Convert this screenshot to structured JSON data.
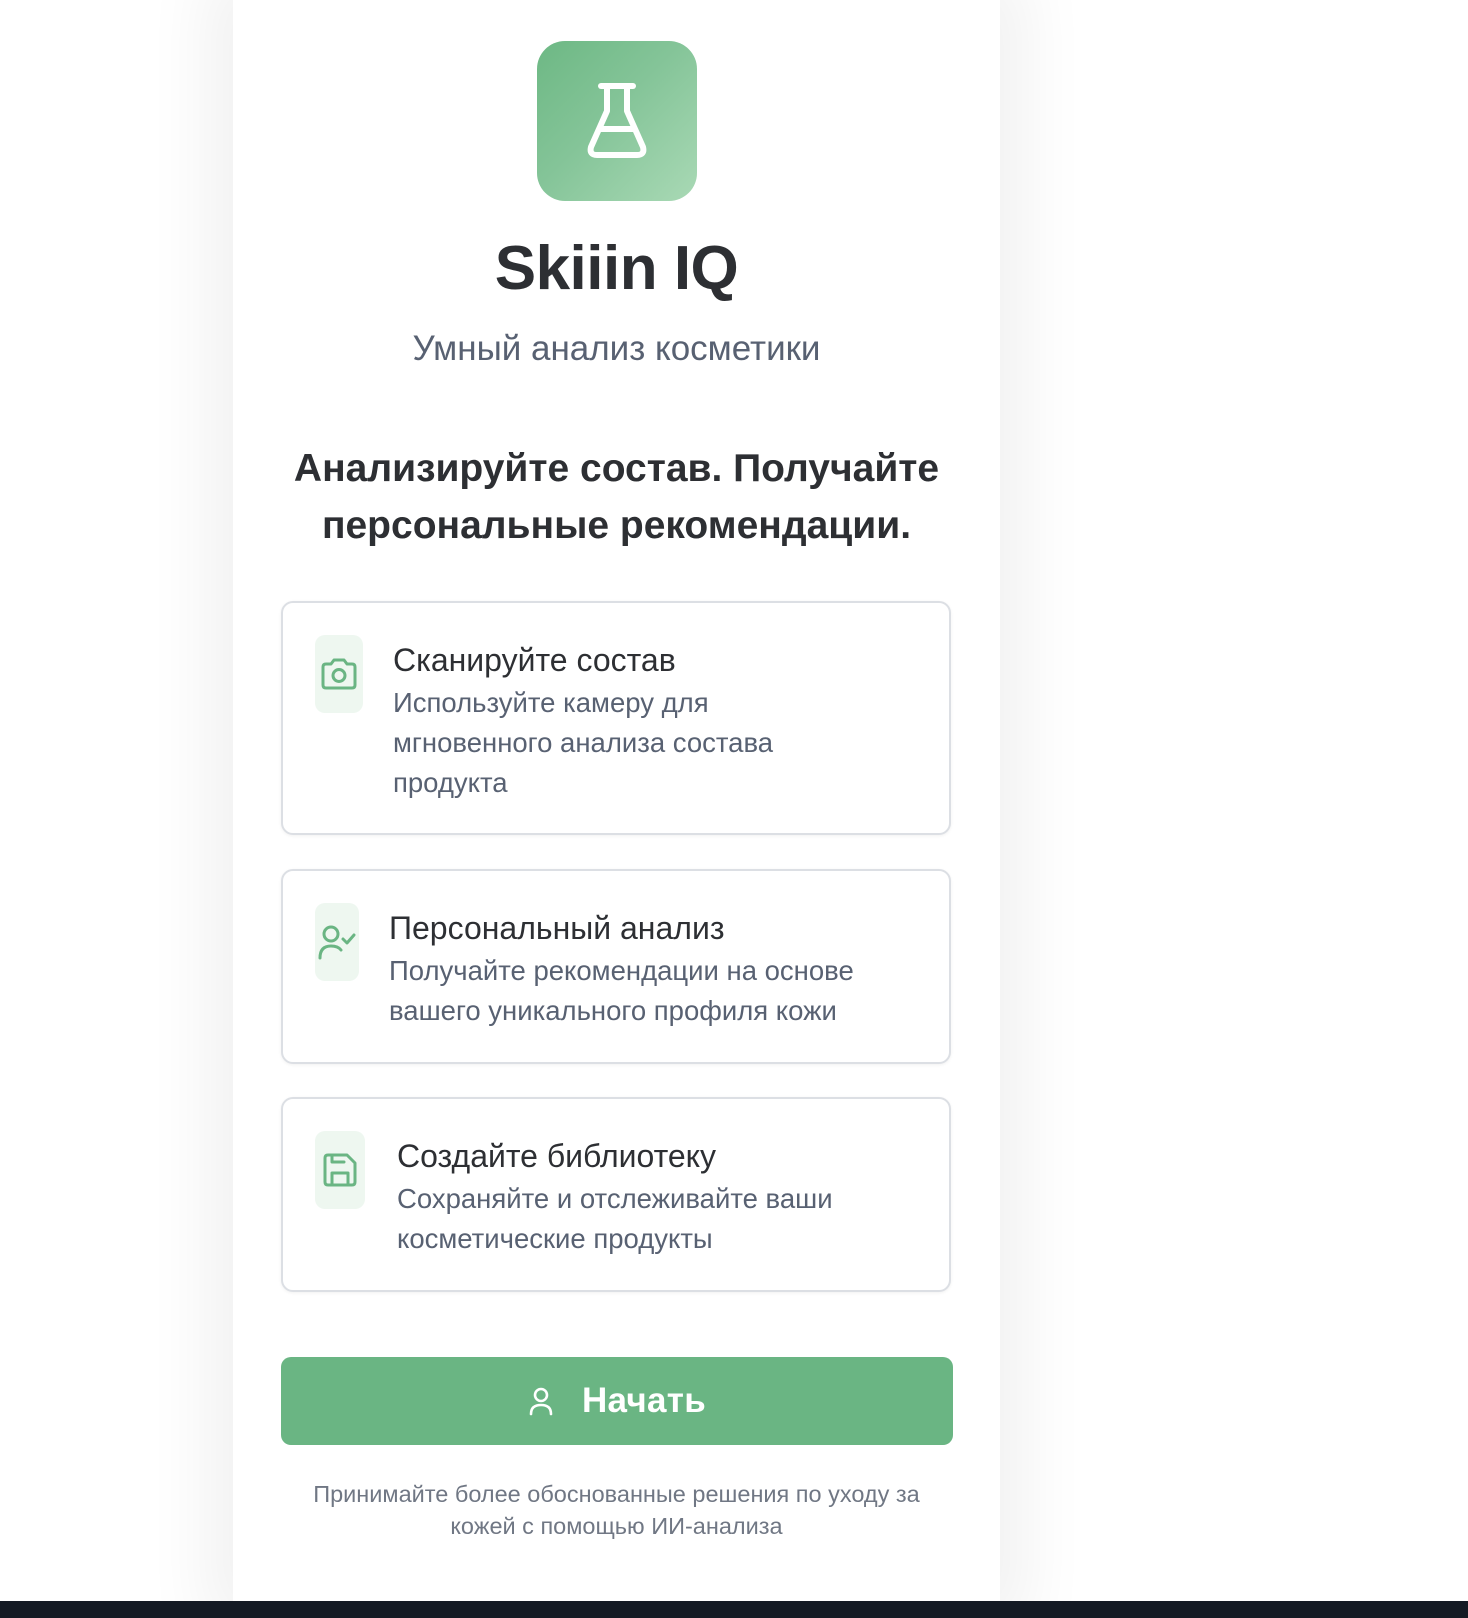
{
  "app": {
    "title": "Skiiin IQ",
    "subtitle": "Умный анализ косметики",
    "logo_icon": "flask-icon",
    "accent_color": "#6ab583"
  },
  "hero": {
    "headline_line1": "Анализируйте состав. Получайте",
    "headline_line2": "персональные рекомендации."
  },
  "features": [
    {
      "icon": "camera-icon",
      "title": "Сканируйте состав",
      "desc_lines": [
        "Используйте камеру для",
        "мгновенного анализа состава",
        "продукта"
      ]
    },
    {
      "icon": "user-check-icon",
      "title": "Персональный анализ",
      "desc_lines": [
        "Получайте рекомендации на основе",
        "вашего уникального профиля кожи"
      ]
    },
    {
      "icon": "save-icon",
      "title": "Создайте библиотеку",
      "desc_lines": [
        "Сохраняйте и отслеживайте ваши",
        "косметические продукты"
      ]
    }
  ],
  "cta": {
    "label": "Начать",
    "icon": "user-icon"
  },
  "footer": {
    "line1": "Принимайте более обоснованные решения по уходу за",
    "line2": "кожей с помощью ИИ-анализа"
  }
}
